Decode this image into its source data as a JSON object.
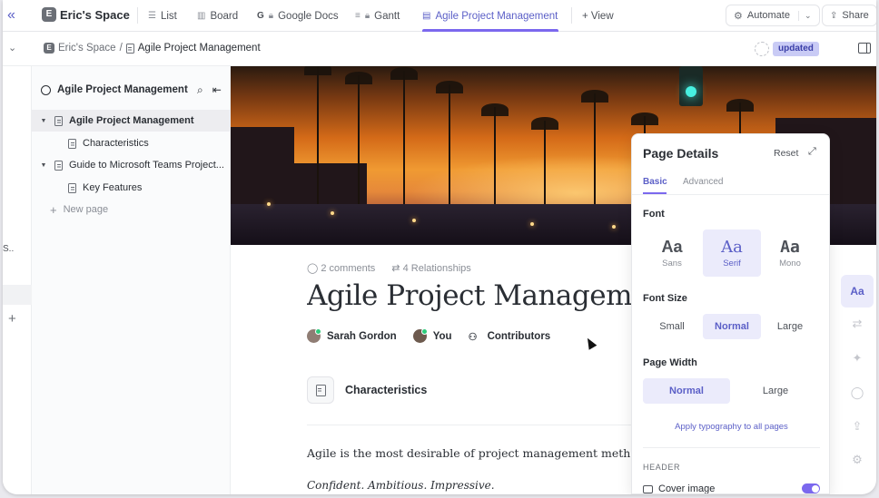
{
  "topbar": {
    "space_badge": "E",
    "space_name": "Eric's Space",
    "tabs": [
      {
        "label": "List",
        "icon": "list-icon"
      },
      {
        "label": "Board",
        "icon": "board-icon"
      },
      {
        "label": "Google Docs",
        "icon": "google-docs-icon"
      },
      {
        "label": "Gantt",
        "icon": "gantt-icon"
      },
      {
        "label": "Agile Project Management",
        "icon": "doc-icon",
        "active": true
      }
    ],
    "add_view_label": "+ View",
    "automate_label": "Automate",
    "share_label": "Share"
  },
  "subbar": {
    "breadcrumb_space": "Eric's Space",
    "breadcrumb_sep": "/",
    "breadcrumb_page": "Agile Project Management",
    "status_badge": "updated"
  },
  "rail": {
    "fragment_text": "S..",
    "plus": "+"
  },
  "sidebar": {
    "title": "Agile Project Management",
    "items": [
      {
        "label": "Agile Project Management",
        "level": 0,
        "expanded": true,
        "selected": true
      },
      {
        "label": "Characteristics",
        "level": 1
      },
      {
        "label": "Guide to Microsoft Teams Project...",
        "level": 0,
        "expanded": true
      },
      {
        "label": "Key Features",
        "level": 1
      }
    ],
    "new_page_label": "New page"
  },
  "doc": {
    "comments": "2 comments",
    "relationships": "4 Relationships",
    "title": "Agile Project Management",
    "people": [
      {
        "label": "Sarah Gordon"
      },
      {
        "label": "You"
      },
      {
        "label": "Contributors"
      }
    ],
    "subpage_card": "Characteristics",
    "body_text": "Agile is the most desirable of project management methodology.",
    "body_italic": "Confident. Ambitious. Impressive."
  },
  "details": {
    "title": "Page Details",
    "reset_label": "Reset",
    "tabs": [
      "Basic",
      "Advanced"
    ],
    "font_label": "Font",
    "fonts": [
      {
        "glyph": "Aa",
        "name": "Sans"
      },
      {
        "glyph": "Aa",
        "name": "Serif",
        "selected": true
      },
      {
        "glyph": "Aa",
        "name": "Mono"
      }
    ],
    "font_size_label": "Font Size",
    "sizes": [
      "Small",
      "Normal",
      "Large"
    ],
    "selected_size": "Normal",
    "page_width_label": "Page Width",
    "widths": [
      "Normal",
      "Large"
    ],
    "selected_width": "Normal",
    "apply_label": "Apply typography to all pages",
    "header_label": "HEADER",
    "cover_image_label": "Cover image",
    "cover_image_on": true
  },
  "tools": {
    "typography_label": "Aa"
  },
  "colors": {
    "accent": "#7b68ee",
    "accent_text": "#5b5fc7",
    "selected_bg": "#ebebfb",
    "status_badge_bg": "#c9cbf5"
  }
}
